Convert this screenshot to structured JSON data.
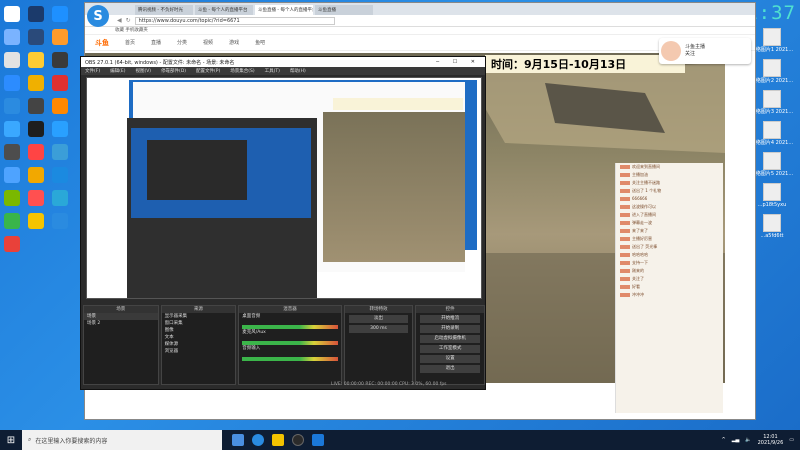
{
  "clock": {
    "time": "12:01:37"
  },
  "browser": {
    "tabs": [
      {
        "label": "腾讯视频 - 不负好时光"
      },
      {
        "label": "斗鱼 - 每个人的直播平台"
      },
      {
        "label": "斗鱼直播 - 每个人的直播平台",
        "active": true
      },
      {
        "label": "斗鱼直播"
      }
    ],
    "address": "https://www.douyu.com/topic/?rid=6671",
    "bookmarks": "收藏  手机收藏夹"
  },
  "site": {
    "logo": "斗鱼",
    "nav": [
      "首页",
      "直播",
      "分类",
      "视频",
      "游戏",
      "鱼吧"
    ],
    "banner": "时间：9月15日-10月13日",
    "streamer": {
      "name": "斗鱼主播",
      "sub": "关注"
    }
  },
  "obs": {
    "title": "OBS 27.0.1 (64-bit, windows) - 配置文件: 未命名 - 场景: 未命名",
    "menu": [
      "文件(F)",
      "编辑(E)",
      "视图(V)",
      "停靠部件(D)",
      "配置文件(P)",
      "场景集合(S)",
      "工具(T)",
      "帮助(H)"
    ],
    "docks": {
      "scenes": {
        "header": "场景",
        "items": [
          "场景",
          "场景 2"
        ]
      },
      "sources": {
        "header": "来源",
        "items": [
          "显示器采集",
          "窗口采集",
          "图像",
          "文本",
          "媒体源",
          "浏览器"
        ]
      },
      "mixer": {
        "header": "混音器",
        "tracks": [
          "桌面音频",
          "麦克风/Aux",
          "音频输入"
        ]
      },
      "transitions": {
        "header": "转场特效",
        "items": [
          "淡出",
          "300 ms"
        ]
      },
      "controls": {
        "header": "控件",
        "buttons": [
          "开始推流",
          "开始录制",
          "启动虚拟摄像机",
          "工作室模式",
          "设置",
          "退出"
        ]
      }
    },
    "status": "LIVE: 00:00:00   REC: 00:00:00   CPU: 3.0%, 60.00 fps"
  },
  "chat": {
    "lines": [
      "欢迎来到直播间",
      "主播加油",
      "关注主播不迷路",
      "送出了 1 个礼物",
      "666666",
      "这波操作可以",
      "进入了直播间",
      "弹幕走一波",
      "来了来了",
      "主播好厉害",
      "送出了 荧光棒",
      "哈哈哈哈",
      "支持一下",
      "刚来的",
      "关注了",
      "好看",
      "冲冲冲"
    ]
  },
  "desktop": {
    "left_icon_colors": [
      "#ffffff",
      "#1b3a6b",
      "#1e90ff",
      "#7ab3ff",
      "#2a4a7a",
      "#ff9b2a",
      "#e2e2e2",
      "#ffcc33",
      "#3a3a3a",
      "#2c8cff",
      "#f0b000",
      "#e03030",
      "#2b8be0",
      "#444444",
      "#ff8800",
      "#3aa8ff",
      "#1e1e1e",
      "#29a0ff",
      "#4d4d4d",
      "#ff4444",
      "#3b9ed8",
      "#4ea3ff",
      "#f2a800",
      "#1b8ae0",
      "#7ab800",
      "#ff5050",
      "#2aa8d8",
      "#39b54a",
      "#f5c400",
      "#2a8be0",
      "#e9413a"
    ],
    "right_icons": [
      {
        "label": "网络图片1 2021..."
      },
      {
        "label": "网络图片2 2021..."
      },
      {
        "label": "网络图片3 2021..."
      },
      {
        "label": "网络图片4 2021..."
      },
      {
        "label": "网络图片5 2021..."
      },
      {
        "label": "...p18t5yxu"
      },
      {
        "label": "...a5fd6tt"
      }
    ]
  },
  "taskbar": {
    "search_placeholder": "在这里输入你要搜索的内容",
    "time": "12:01",
    "date": "2021/9/26"
  }
}
